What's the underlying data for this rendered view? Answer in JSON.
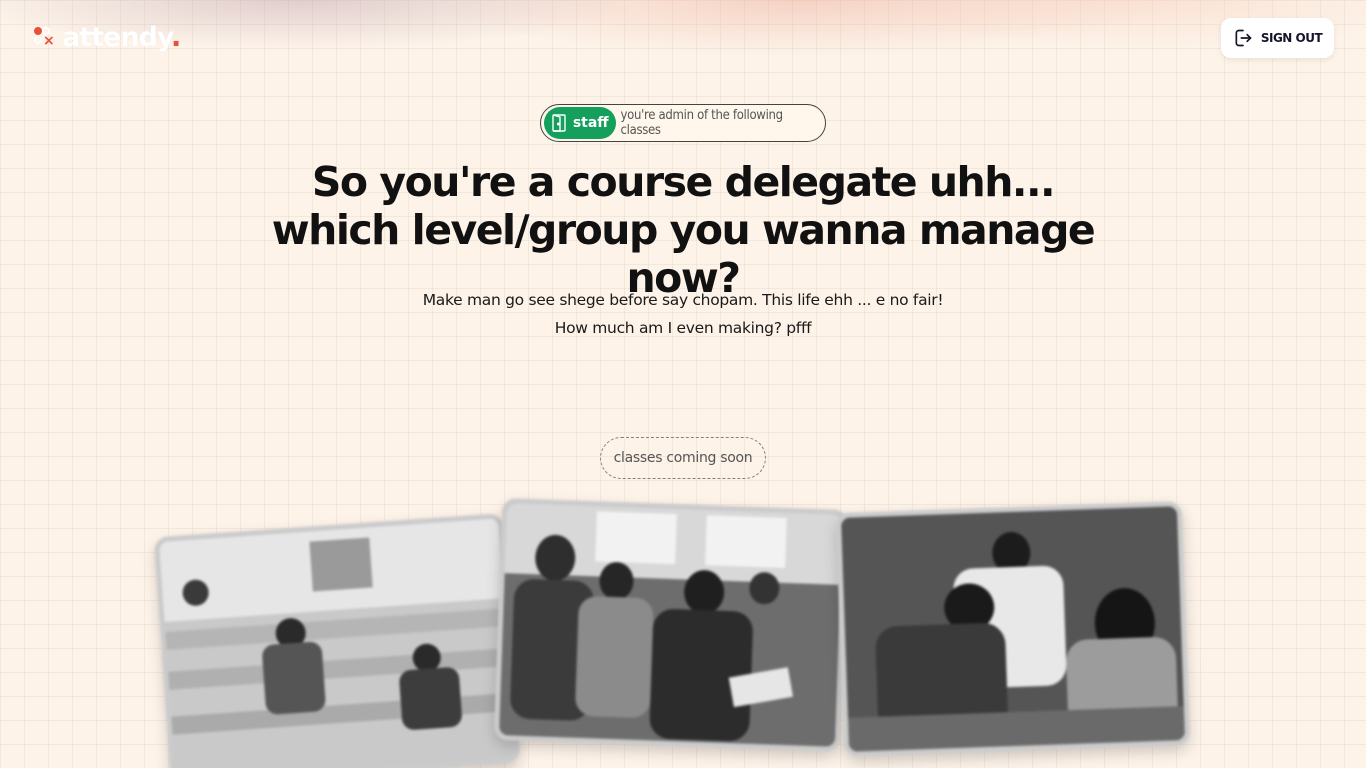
{
  "brand": {
    "name": "attendy",
    "period": "."
  },
  "header": {
    "signout_label": "SIGN OUT"
  },
  "role_pill": {
    "badge": "staff",
    "text": "you're admin of the following classes"
  },
  "headline": {
    "line1": "So you're a course delegate uhh...",
    "line2": "which level/group you wanna manage now?"
  },
  "subtext": {
    "line1": "Make man go see shege before say chopam. This life ehh ... e no fair!",
    "line2": "How much am I even making? pfff"
  },
  "status": {
    "coming_soon": "classes coming soon"
  },
  "colors": {
    "accent_green": "#14a05c",
    "brand_red": "#e8503a",
    "background": "#fdf3e9"
  },
  "icons": {
    "signout": "logout-icon",
    "badge": "door-icon"
  }
}
